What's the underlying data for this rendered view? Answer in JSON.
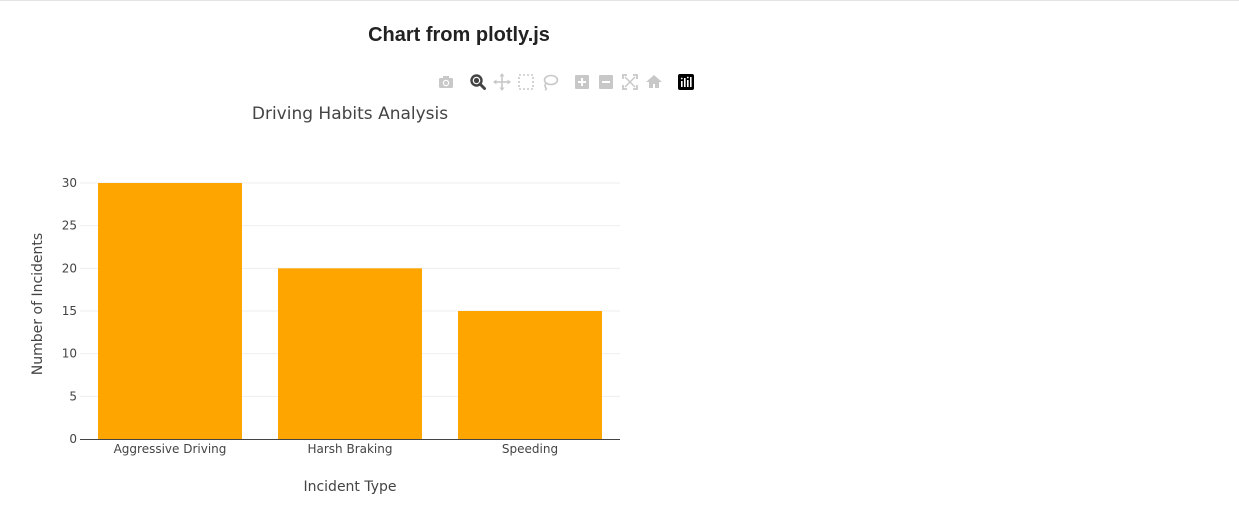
{
  "page": {
    "heading": "Chart from plotly.js"
  },
  "modebar": {
    "buttons": [
      {
        "icon": "camera-icon"
      },
      {
        "icon": "zoom-icon"
      },
      {
        "icon": "pan-icon"
      },
      {
        "icon": "box-select-icon"
      },
      {
        "icon": "lasso-select-icon"
      },
      {
        "icon": "zoom-in-icon"
      },
      {
        "icon": "zoom-out-icon"
      },
      {
        "icon": "autoscale-icon"
      },
      {
        "icon": "reset-axes-icon"
      },
      {
        "icon": "plotly-logo-icon"
      }
    ],
    "icon_color": "#c8c8c8",
    "active_icon_color": "#444444"
  },
  "chart_data": {
    "type": "bar",
    "title": "Driving Habits Analysis",
    "xlabel": "Incident Type",
    "ylabel": "Number of Incidents",
    "categories": [
      "Aggressive Driving",
      "Harsh Braking",
      "Speeding"
    ],
    "values": [
      30,
      20,
      15
    ],
    "ylim": [
      0,
      30
    ],
    "yticks": [
      "0",
      "5",
      "10",
      "15",
      "20",
      "25",
      "30"
    ],
    "grid": true,
    "bar_color": "#ffa500"
  }
}
